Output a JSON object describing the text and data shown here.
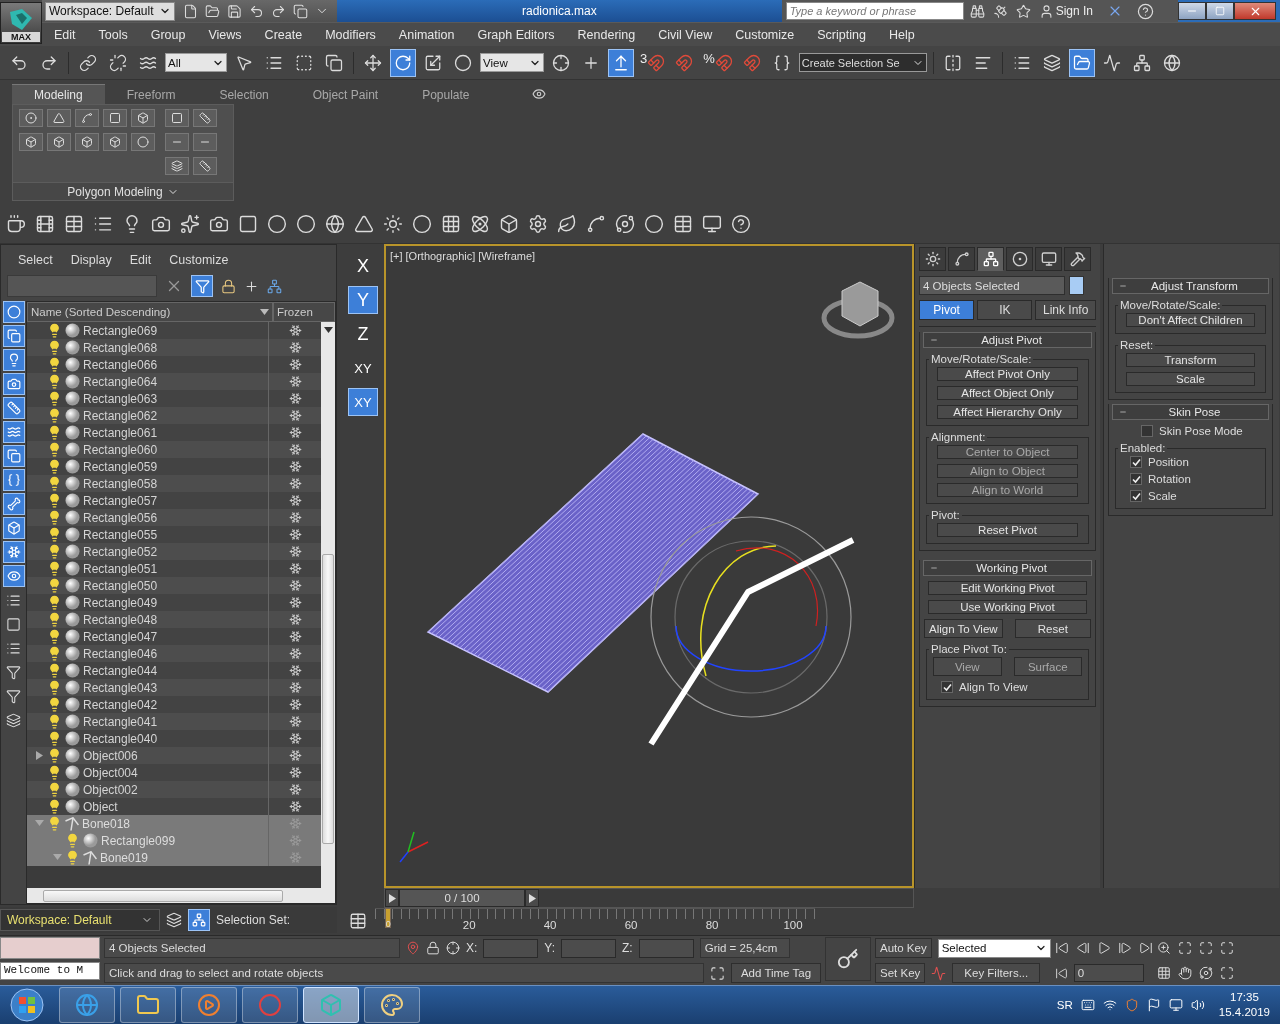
{
  "title_bar": {
    "logo": "MAX",
    "workspace": "Workspace: Default",
    "title": "radionica.max",
    "search": {
      "placeholder": "Type a keyword or phrase"
    },
    "sign_in": "Sign In"
  },
  "menu": [
    "Edit",
    "Tools",
    "Group",
    "Views",
    "Create",
    "Modifiers",
    "Animation",
    "Graph Editors",
    "Rendering",
    "Civil View",
    "Customize",
    "Scripting",
    "Help"
  ],
  "main_toolbar": [
    {
      "kind": "undo",
      "selected": false
    },
    {
      "kind": "redo",
      "selected": false
    },
    {
      "kind": "link",
      "selected": false
    },
    {
      "kind": "unlink",
      "selected": false
    },
    {
      "kind": "bind",
      "selected": false
    },
    {
      "kind": "dropdown",
      "value": "All"
    },
    {
      "kind": "select",
      "selected": false
    },
    {
      "kind": "select_by_name",
      "selected": false
    },
    {
      "kind": "region",
      "selected": false
    },
    {
      "kind": "crossing",
      "selected": false
    },
    {
      "kind": "move",
      "selected": false
    },
    {
      "kind": "rotate",
      "selected": true
    },
    {
      "kind": "scale",
      "selected": false
    },
    {
      "kind": "placement",
      "selected": false
    },
    {
      "kind": "dropdown",
      "value": "View"
    },
    {
      "kind": "pivot",
      "selected": false
    },
    {
      "kind": "manipulate",
      "selected": false
    },
    {
      "kind": "override",
      "selected": true
    },
    {
      "kind": "snap",
      "label": "3",
      "selected": false
    },
    {
      "kind": "snap",
      "selected": false
    },
    {
      "kind": "snap",
      "label": "%",
      "selected": false
    },
    {
      "kind": "snap",
      "selected": false
    },
    {
      "kind": "named_sets",
      "selected": false
    },
    {
      "kind": "named_dropdown",
      "value": "Create Selection Se"
    },
    {
      "kind": "mirror",
      "selected": false
    },
    {
      "kind": "align",
      "selected": false
    },
    {
      "kind": "layer_list",
      "selected": false
    },
    {
      "kind": "layers",
      "selected": false
    },
    {
      "kind": "explorer",
      "selected": true
    },
    {
      "kind": "curves",
      "selected": false
    },
    {
      "kind": "schematic",
      "selected": false
    },
    {
      "kind": "material",
      "selected": false
    }
  ],
  "ribbon": {
    "tabs": [
      {
        "label": "Modeling",
        "selected": true
      },
      {
        "label": "Freeform",
        "selected": false
      },
      {
        "label": "Selection",
        "selected": false
      },
      {
        "label": "Object Paint",
        "selected": false
      },
      {
        "label": "Populate",
        "selected": false
      }
    ],
    "panel_title": "Polygon Modeling"
  },
  "scene_explorer": {
    "menu": [
      "Select",
      "Display",
      "Edit",
      "Customize"
    ],
    "filters": [
      {
        "kind": "geometry",
        "selected": true
      },
      {
        "kind": "shapes",
        "selected": true
      },
      {
        "kind": "lights",
        "selected": true
      },
      {
        "kind": "cameras",
        "selected": true
      },
      {
        "kind": "helpers",
        "selected": true
      },
      {
        "kind": "warps",
        "selected": true
      },
      {
        "kind": "groups",
        "selected": true
      },
      {
        "kind": "xrefs",
        "selected": true
      },
      {
        "kind": "bones",
        "selected": true
      },
      {
        "kind": "containers",
        "selected": true
      },
      {
        "kind": "frozen",
        "selected": true
      },
      {
        "kind": "hidden",
        "selected": true
      },
      {
        "kind": "all",
        "selected": false
      },
      {
        "kind": "none",
        "selected": false
      },
      {
        "kind": "invert",
        "selected": false
      },
      {
        "kind": "filter",
        "selected": false
      },
      {
        "kind": "filter_settings",
        "selected": false
      },
      {
        "kind": "layer",
        "selected": false
      }
    ],
    "columns": [
      "Name (Sorted Descending)",
      "Frozen"
    ],
    "rows": [
      {
        "name": "Rectangle069",
        "kind": "object",
        "selected": false
      },
      {
        "name": "Rectangle068",
        "kind": "object",
        "selected": false
      },
      {
        "name": "Rectangle066",
        "kind": "object",
        "selected": false
      },
      {
        "name": "Rectangle064",
        "kind": "object",
        "selected": false
      },
      {
        "name": "Rectangle063",
        "kind": "object",
        "selected": false
      },
      {
        "name": "Rectangle062",
        "kind": "object",
        "selected": false
      },
      {
        "name": "Rectangle061",
        "kind": "object",
        "selected": false
      },
      {
        "name": "Rectangle060",
        "kind": "object",
        "selected": false
      },
      {
        "name": "Rectangle059",
        "kind": "object",
        "selected": false
      },
      {
        "name": "Rectangle058",
        "kind": "object",
        "selected": false
      },
      {
        "name": "Rectangle057",
        "kind": "object",
        "selected": false
      },
      {
        "name": "Rectangle056",
        "kind": "object",
        "selected": false
      },
      {
        "name": "Rectangle055",
        "kind": "object",
        "selected": false
      },
      {
        "name": "Rectangle052",
        "kind": "object",
        "selected": false
      },
      {
        "name": "Rectangle051",
        "kind": "object",
        "selected": false
      },
      {
        "name": "Rectangle050",
        "kind": "object",
        "selected": false
      },
      {
        "name": "Rectangle049",
        "kind": "object",
        "selected": false
      },
      {
        "name": "Rectangle048",
        "kind": "object",
        "selected": false
      },
      {
        "name": "Rectangle047",
        "kind": "object",
        "selected": false
      },
      {
        "name": "Rectangle046",
        "kind": "object",
        "selected": false
      },
      {
        "name": "Rectangle044",
        "kind": "object",
        "selected": false
      },
      {
        "name": "Rectangle043",
        "kind": "object",
        "selected": false
      },
      {
        "name": "Rectangle042",
        "kind": "object",
        "selected": false
      },
      {
        "name": "Rectangle041",
        "kind": "object",
        "selected": false
      },
      {
        "name": "Rectangle040",
        "kind": "object",
        "selected": false
      },
      {
        "name": "Object006",
        "kind": "object",
        "selected": false,
        "expanded": false
      },
      {
        "name": "Object004",
        "kind": "object",
        "selected": false
      },
      {
        "name": "Object002",
        "kind": "object",
        "selected": false
      },
      {
        "name": "Object",
        "kind": "object",
        "selected": false
      },
      {
        "name": "Bone018",
        "kind": "bone",
        "selected": true,
        "expanded": true,
        "children": [
          {
            "name": "Rectangle099",
            "kind": "object",
            "selected": true
          },
          {
            "name": "Bone019",
            "kind": "bone",
            "selected": true,
            "expanded": true
          }
        ]
      }
    ]
  },
  "axis_constraints": [
    {
      "label": "X",
      "selected": false
    },
    {
      "label": "Y",
      "selected": true
    },
    {
      "label": "Z",
      "selected": false
    },
    {
      "label": "XY",
      "selected": false
    },
    {
      "label": "XY",
      "selected": true
    }
  ],
  "viewport": {
    "labels": [
      "[+]",
      "[Orthographic]",
      "[Wireframe]"
    ],
    "active": true
  },
  "command_panel": {
    "tabs": [
      {
        "kind": "create",
        "selected": false
      },
      {
        "kind": "modify",
        "selected": false
      },
      {
        "kind": "hierarchy",
        "selected": true
      },
      {
        "kind": "motion",
        "selected": false
      },
      {
        "kind": "display",
        "selected": false
      },
      {
        "kind": "utilities",
        "selected": false
      }
    ],
    "selection_name": "4 Objects Selected",
    "modes": [
      {
        "label": "Pivot",
        "selected": true
      },
      {
        "label": "IK",
        "selected": false
      },
      {
        "label": "Link Info",
        "selected": false
      }
    ],
    "rollouts": [
      {
        "title": "Adjust Pivot",
        "items": [
          {
            "kind": "group",
            "title": "Move/Rotate/Scale:",
            "items": [
              {
                "kind": "button",
                "label": "Affect Pivot Only",
                "disabled": false
              },
              {
                "kind": "button",
                "label": "Affect Object Only",
                "disabled": false
              },
              {
                "kind": "button",
                "label": "Affect Hierarchy Only",
                "disabled": false
              }
            ]
          },
          {
            "kind": "group",
            "title": "Alignment:",
            "items": [
              {
                "kind": "button",
                "label": "Center to Object",
                "disabled": true
              },
              {
                "kind": "button",
                "label": "Align to Object",
                "disabled": true
              },
              {
                "kind": "button",
                "label": "Align to World",
                "disabled": true
              }
            ]
          },
          {
            "kind": "group",
            "title": "Pivot:",
            "items": [
              {
                "kind": "button",
                "label": "Reset Pivot",
                "disabled": false
              }
            ]
          }
        ]
      },
      {
        "title": "Working Pivot",
        "items": [
          {
            "kind": "button",
            "label": "Edit Working Pivot",
            "disabled": false
          },
          {
            "kind": "button",
            "label": "Use Working Pivot",
            "disabled": false
          },
          {
            "kind": "row",
            "items": [
              {
                "kind": "button",
                "label": "Align To View",
                "disabled": false
              },
              {
                "kind": "button",
                "label": "Reset",
                "disabled": false
              }
            ]
          },
          {
            "kind": "group",
            "title": "Place Pivot To:",
            "items": [
              {
                "kind": "row",
                "items": [
                  {
                    "kind": "button",
                    "label": "View",
                    "disabled": true
                  },
                  {
                    "kind": "button",
                    "label": "Surface",
                    "disabled": true
                  }
                ]
              },
              {
                "kind": "checkbox",
                "label": "Align To View",
                "checked": true
              }
            ]
          }
        ]
      }
    ]
  },
  "side_rollouts": [
    {
      "title": "Adjust Transform",
      "items": [
        {
          "kind": "group",
          "title": "Move/Rotate/Scale:",
          "items": [
            {
              "kind": "button",
              "label": "Don't Affect Children",
              "disabled": false
            }
          ]
        },
        {
          "kind": "group",
          "title": "Reset:",
          "items": [
            {
              "kind": "button",
              "label": "Transform",
              "disabled": false
            },
            {
              "kind": "button",
              "label": "Scale",
              "disabled": false
            }
          ]
        }
      ]
    },
    {
      "title": "Skin Pose",
      "items": [
        {
          "kind": "checkbox",
          "label": "Skin Pose Mode",
          "checked": false
        },
        {
          "kind": "group",
          "title": "Enabled:",
          "items": [
            {
              "kind": "checkbox",
              "label": "Position",
              "checked": true
            },
            {
              "kind": "checkbox",
              "label": "Rotation",
              "checked": true
            },
            {
              "kind": "checkbox",
              "label": "Scale",
              "checked": true
            }
          ]
        }
      ]
    }
  ],
  "timeline": {
    "frame_label": "0 / 100",
    "level": 0,
    "ticks": [
      "0",
      "20",
      "40",
      "60",
      "80",
      "100"
    ]
  },
  "status_bar": {
    "workspace": "Workspace: Default",
    "selection_set": "Selection Set:",
    "script_output": "Welcome to M",
    "selection_info": "4 Objects Selected",
    "prompt": "Click and drag to select and rotate objects",
    "coords": [
      "X:",
      "Y:",
      "Z:"
    ],
    "grid": "Grid = 25,4cm",
    "time_tag": "Add Time Tag",
    "auto_key": "Auto Key",
    "set_key": "Set Key",
    "key_mode": "Selected",
    "key_filters": "Key Filters...",
    "frame": "0"
  },
  "taskbar": {
    "apps": [
      {
        "kind": "ie",
        "selected": false
      },
      {
        "kind": "files",
        "selected": false
      },
      {
        "kind": "media",
        "selected": false
      },
      {
        "kind": "browser",
        "selected": false
      },
      {
        "kind": "max",
        "selected": true
      },
      {
        "kind": "paint",
        "selected": false
      }
    ],
    "language": "SR",
    "time": "17:35",
    "date": "15.4.2019"
  }
}
